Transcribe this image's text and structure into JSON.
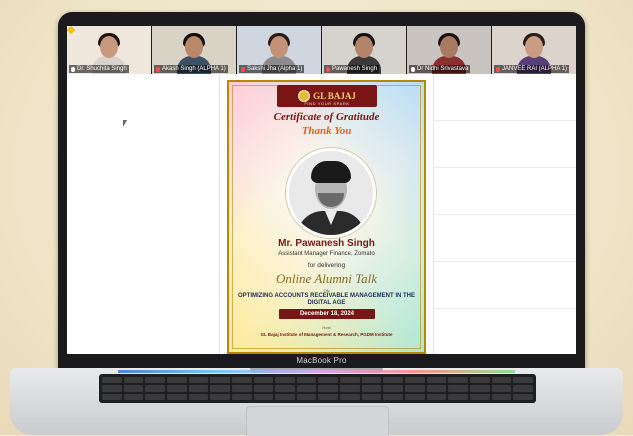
{
  "device": {
    "label": "MacBook Pro"
  },
  "participants": [
    {
      "name": "Dr. Shuchita Singh",
      "skin": "#c79a80",
      "hair": "#1e130e",
      "shirt": "#d7d2cc",
      "bg": "#efe7dc",
      "muted": false
    },
    {
      "name": "Akash Singh (ALPHA 1)",
      "skin": "#b9876a",
      "hair": "#120c08",
      "shirt": "#3d5166",
      "bg": "#d9d3c6",
      "muted": true
    },
    {
      "name": "Sakshi Jha (Alpha 1)",
      "skin": "#c39378",
      "hair": "#2a1b14",
      "shirt": "#8c8c8c",
      "bg": "#cfd6df",
      "muted": true
    },
    {
      "name": "Pawanesh Singh",
      "skin": "#b3846a",
      "hair": "#151010",
      "shirt": "#3a3a3a",
      "bg": "#d6d3ce",
      "muted": true
    },
    {
      "name": "Dr Nidhi Srivastava",
      "skin": "#a97a62",
      "hair": "#1b1110",
      "shirt": "#8b2e2e",
      "bg": "#c9c4bf",
      "muted": false
    },
    {
      "name": "JANVEE RAI (ALPHA 1)",
      "skin": "#c99c84",
      "hair": "#2b1c16",
      "shirt": "#5a3e7a",
      "bg": "#dcd3cd",
      "muted": true
    }
  ],
  "certificate": {
    "logo": "GL BAJAJ",
    "tagline": "FIND YOUR SPARK",
    "title": "Certificate of Gratitude",
    "thanks": "Thank You",
    "name": "Mr. Pawanesh Singh",
    "role": "Assistant Manager Finance, Zomato",
    "for_text": "for delivering",
    "event": "Online Alumni Talk",
    "on_text": "ON",
    "topic": "OPTIMIZING ACCOUNTS RECEIVABLE MANAGEMENT IN THE DIGITAL AGE",
    "date": "December 18, 2024",
    "host_text": "Host",
    "institute": "GL Bajaj Institute of Management & Research, PGDM Institute"
  },
  "colors": {
    "active_speaker": "#2ecc40",
    "accent_maroon": "#7a1515"
  }
}
